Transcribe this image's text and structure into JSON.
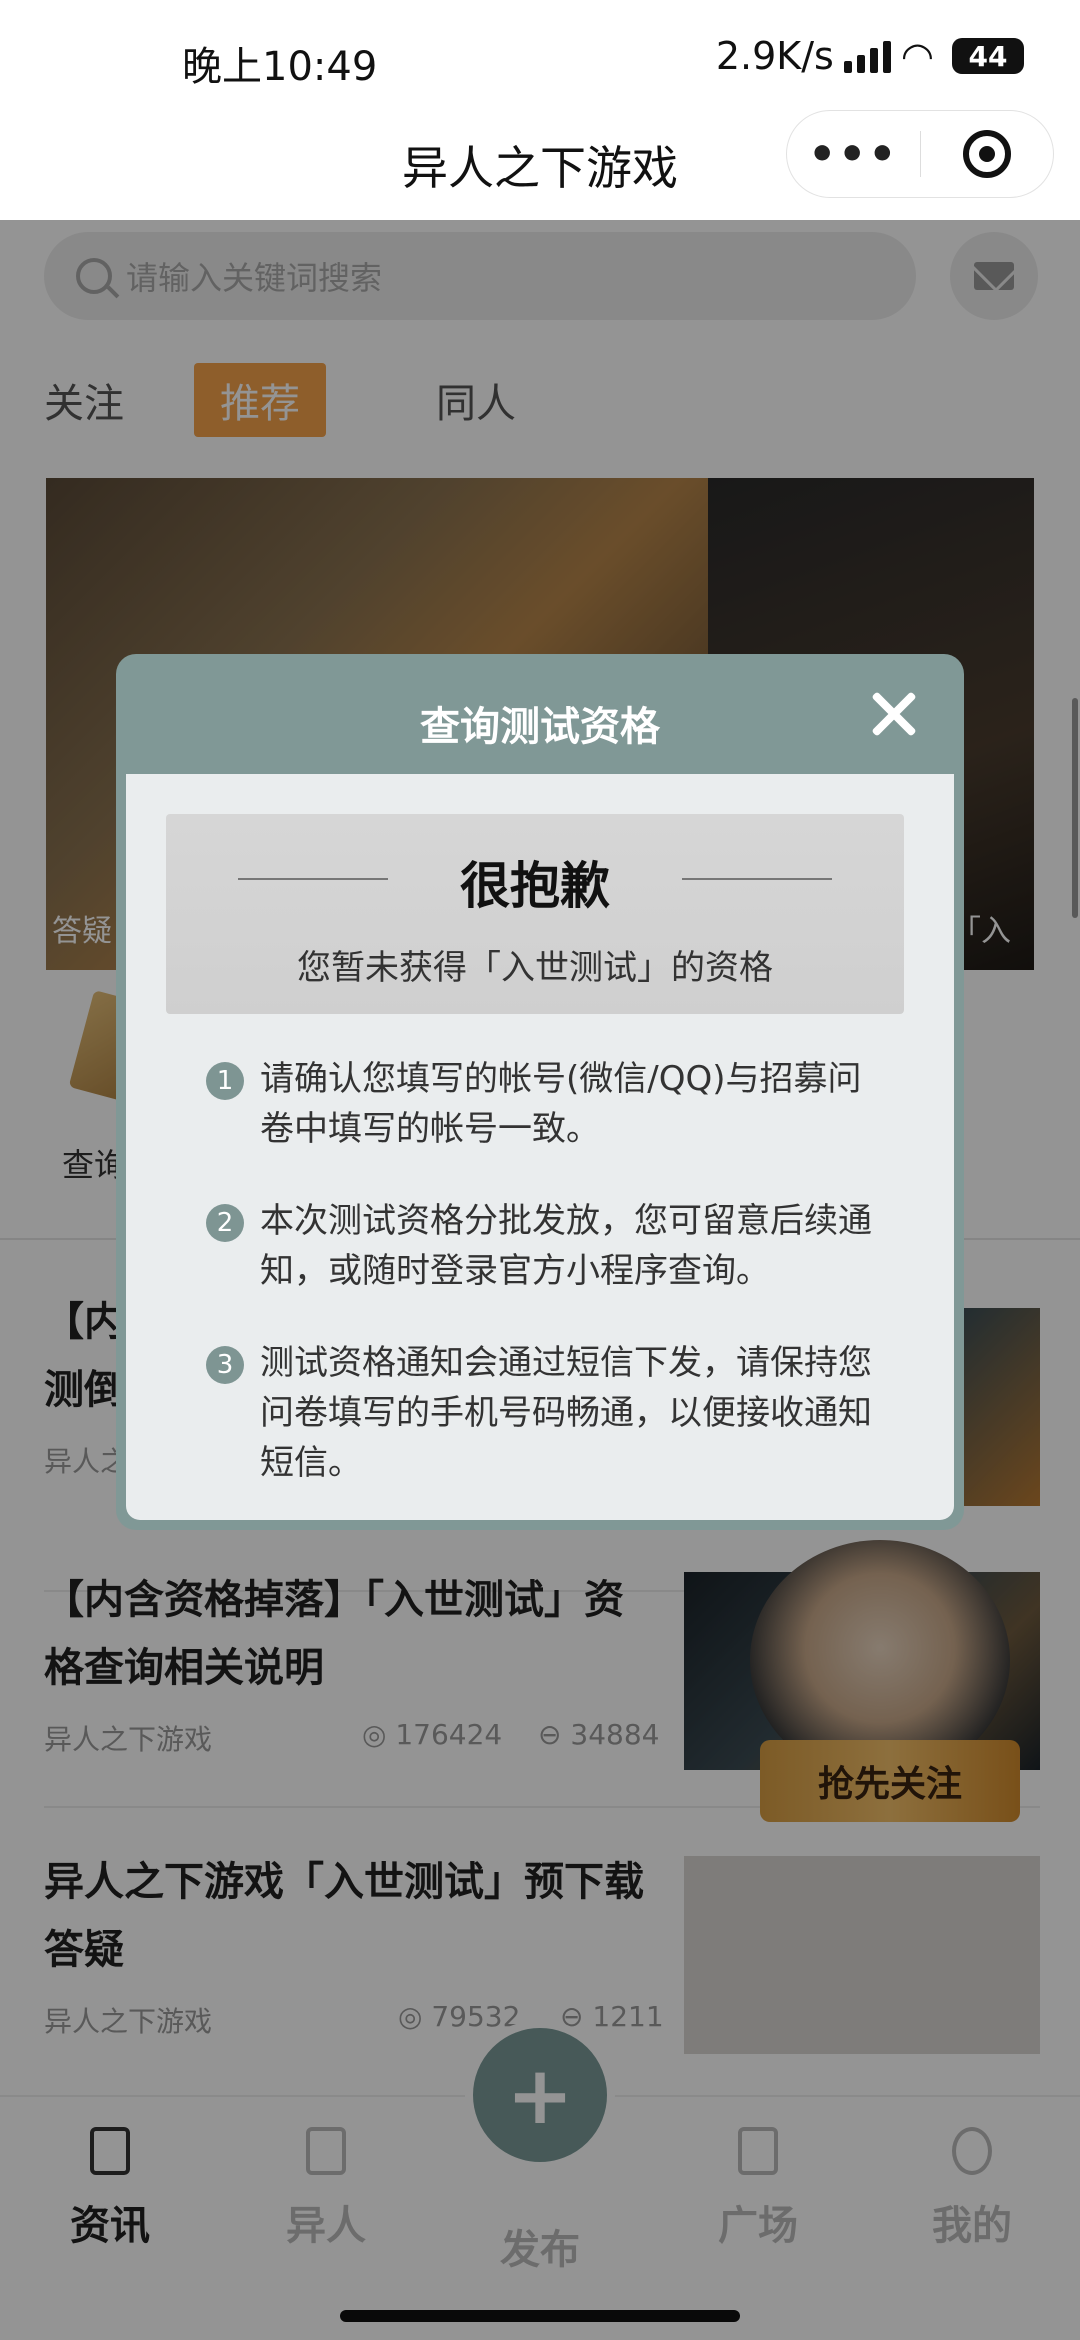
{
  "status_bar": {
    "time": "晚上10:49",
    "net_speed": "2.9K/s",
    "battery": "44"
  },
  "navbar": {
    "title": "异人之下游戏",
    "more_icon": "•••"
  },
  "search": {
    "placeholder": "请输入关键词搜索"
  },
  "tabs": [
    {
      "label": "关注"
    },
    {
      "label": "推荐",
      "active": true
    },
    {
      "label": "同人"
    }
  ],
  "banner": {
    "caption_left": "答疑",
    "caption_right": "落】「入"
  },
  "entry": {
    "label": "查询"
  },
  "articles": [
    {
      "title_partial": "【内",
      "title_partial_2": "测倒",
      "source_partial": "异人之"
    },
    {
      "title": "【内含资格掉落】「入世测试」资格查询相关说明",
      "source": "异人之下游戏",
      "views": "176424",
      "comments": "34884"
    },
    {
      "title": "异人之下游戏「入世测试」预下载答疑",
      "source": "异人之下游戏",
      "views": "79532",
      "comments": "1211"
    }
  ],
  "promo": {
    "button": "抢先关注"
  },
  "tabbar": {
    "items": [
      {
        "label": "资讯",
        "active": true,
        "icon": "news-icon"
      },
      {
        "label": "异人",
        "icon": "scroll-icon"
      },
      {
        "label": "发布",
        "icon": "plus-icon"
      },
      {
        "label": "广场",
        "icon": "chat-icon"
      },
      {
        "label": "我的",
        "icon": "user-icon"
      }
    ],
    "fab": "+"
  },
  "modal": {
    "title": "查询测试资格",
    "sorry_title": "很抱歉",
    "sorry_sub": "您暂未获得「入世测试」的资格",
    "notes": [
      {
        "num": "1",
        "text": "请确认您填写的帐号(微信/QQ)与招募问卷中填写的帐号一致。"
      },
      {
        "num": "2",
        "text": "本次测试资格分批发放，您可留意后续通知，或随时登录官方小程序查询。"
      },
      {
        "num": "3",
        "text": "测试资格通知会通过短信下发，请保持您问卷填写的手机号码畅通，以便接收通知短信。"
      }
    ]
  },
  "colors": {
    "accent": "#f5a24b",
    "modal_header": "#809896",
    "modal_body": "#eaedee"
  }
}
